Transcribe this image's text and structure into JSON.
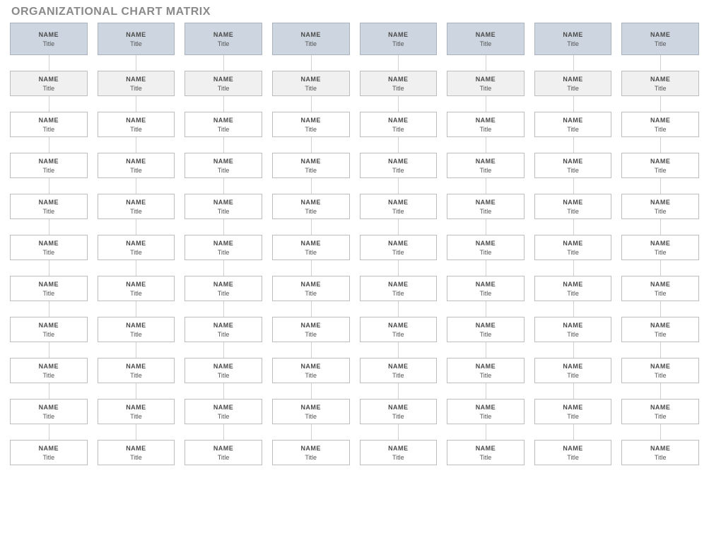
{
  "page_title": "ORGANIZATIONAL CHART MATRIX",
  "columns": 8,
  "rows": 11,
  "cell_default": {
    "name": "NAME",
    "title": "Title"
  },
  "row_styles": [
    "header-1",
    "header-2",
    "",
    "",
    "",
    "",
    "",
    "",
    "",
    "",
    ""
  ]
}
